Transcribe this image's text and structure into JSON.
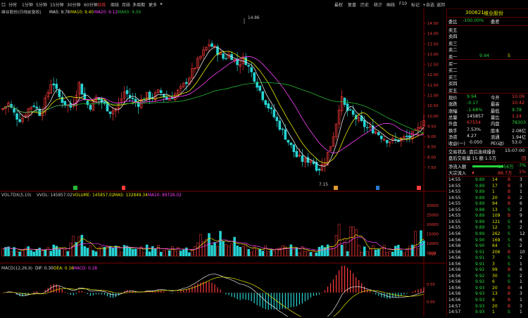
{
  "topbar": {
    "home": "口",
    "tabs": [
      {
        "label": "分时",
        "active": false
      },
      {
        "label": "1分钟",
        "active": false
      },
      {
        "label": "5分钟",
        "active": false
      },
      {
        "label": "15分钟",
        "active": false
      },
      {
        "label": "30分钟",
        "active": false
      },
      {
        "label": "60分钟",
        "active": false
      },
      {
        "label": "日线",
        "active": true
      },
      {
        "label": "周线",
        "active": false
      },
      {
        "label": "月线",
        "active": false
      },
      {
        "label": "多周期",
        "active": false
      },
      {
        "label": "更多",
        "active": false
      }
    ],
    "right_items": [
      "最权",
      "复盘",
      "历史",
      "统计",
      "画线",
      "F10",
      "标记",
      "+自选",
      "返回"
    ]
  },
  "kline": {
    "title": "维业股份(日线前复权)",
    "ma5": "MA5: 9.78",
    "ma10": "MA10: 9.40",
    "ma20": "MA20: 9.12",
    "ma60": "MA60: 9.09",
    "high_label": "14.86",
    "low_label": "7.15",
    "y_ticks": [
      "14.50",
      "14.00",
      "13.50",
      "13.00",
      "12.50",
      "12.00",
      "11.50",
      "11.00",
      "10.50",
      "10.00",
      "9.50",
      "9.00",
      "8.50",
      "8.00",
      "7.50"
    ]
  },
  "volume": {
    "title": "VOL-TDX(5,10)",
    "vvol": "VVOL: 145857.02",
    "vol": "VOLUME: 145857.02",
    "ma5": "MA5: 132849.34",
    "ma10": "MA10: 89726.02",
    "y_ticks": [
      "30000",
      "25000",
      "20000",
      "15000",
      "10000",
      "5000"
    ],
    "unit": "X10"
  },
  "macd": {
    "title": "MACD(12,26,9)",
    "dif": "DIF: 0.30",
    "dea": "DEA: 0.16",
    "macd": "MACD: 0.28",
    "y_ticks": [
      "0.50",
      "0.00"
    ]
  },
  "colors": {
    "up": "#ff3b3b",
    "down": "#27d4d4",
    "ma5": "#e6e6e6",
    "ma10": "#e8e800",
    "ma20": "#ff40ff",
    "ma60": "#27b437",
    "border": "#7a0000"
  },
  "panel": {
    "code": "300621",
    "name": "维业股份",
    "weibi_label": "委比",
    "weibi_value": "-100.00%",
    "weicha_label": "委差",
    "weicha_value": "",
    "asks": [
      "卖五",
      "卖四",
      "卖三",
      "卖二",
      "卖一"
    ],
    "ask1_price": "9.94",
    "ask1_vol": "5",
    "bids": [
      "买一",
      "买二",
      "买三",
      "买四",
      "买五"
    ],
    "quote": [
      {
        "l1": "现价",
        "v1": "9.94",
        "l2": "今开",
        "v2": "10.09"
      },
      {
        "l1": "涨跌",
        "v1": "-0.17",
        "l2": "最高",
        "v2": "10.42"
      },
      {
        "l1": "涨幅",
        "v1": "-1.68%",
        "l2": "最低",
        "v2": "9.78"
      },
      {
        "l1": "总量",
        "v1": "145857",
        "l2": "量比",
        "v2": "1.24"
      },
      {
        "l1": "外盘",
        "v1": "67554",
        "l2": "内盘",
        "v2": "78303"
      },
      {
        "l1": "换手",
        "v1": "7.53%",
        "l2": "股本",
        "v2": "2.08亿"
      },
      {
        "l1": "净资",
        "v1": "4.27",
        "l2": "流通",
        "v2": "1.94亿"
      },
      {
        "l1": "收益(一)",
        "v1": "0.050",
        "l2": "PE(动)",
        "v2": "53.0"
      }
    ],
    "status": "交易状态: 盘后连续撮合",
    "status_time": "15:07:00",
    "after_trade": "盘后交易量 15 额 1.5万",
    "after_mark": "回",
    "net_inflow_label": "净流入额",
    "net_inflow_value": "-1056万",
    "net_inflow_pct": "-7%",
    "big_inflow_label": "大宗流入",
    "big_inflow_value": "86.7万",
    "big_inflow_pct": "1%",
    "ticks": [
      [
        "14:55",
        "9.89",
        "14",
        "B",
        "3"
      ],
      [
        "14:55",
        "9.89",
        "17",
        "B",
        "3"
      ],
      [
        "14:55",
        "9.89",
        "1",
        "B",
        "1"
      ],
      [
        "14:55",
        "9.89",
        "20",
        "B",
        "2"
      ],
      [
        "14:55",
        "9.89",
        "94",
        "B",
        "6"
      ],
      [
        "14:55",
        "9.88",
        "13",
        "S",
        "2"
      ],
      [
        "14:55",
        "9.89",
        "109",
        "B",
        "9"
      ],
      [
        "14:55",
        "9.89",
        "121",
        "S",
        "4"
      ],
      [
        "14:55",
        "9.89",
        "12",
        "S",
        "2"
      ],
      [
        "14:56",
        "9.89",
        "262",
        "S",
        "12"
      ],
      [
        "14:56",
        "9.90",
        "169",
        "S",
        "6"
      ],
      [
        "14:56",
        "9.90",
        "64",
        "S",
        "2"
      ],
      [
        "14:56",
        "9.91",
        "206",
        "B",
        "10"
      ],
      [
        "14:56",
        "9.91",
        "7",
        "S",
        "2"
      ],
      [
        "14:56",
        "9.91",
        "3",
        "S",
        "1"
      ],
      [
        "14:56",
        "9.92",
        "99",
        "B",
        "6"
      ],
      [
        "14:56",
        "9.92",
        "30",
        "S",
        "2"
      ],
      [
        "14:56",
        "9.92",
        "6",
        "S",
        "1"
      ],
      [
        "14:56",
        "9.93",
        "20",
        "B",
        "4"
      ],
      [
        "14:56",
        "9.93",
        "13",
        "B",
        "3"
      ],
      [
        "14:56",
        "9.93",
        "6",
        "B",
        "1"
      ],
      [
        "14:57",
        "9.93",
        "20",
        "B",
        "3"
      ],
      [
        "14:57",
        "9.93",
        "1",
        "S",
        "1"
      ]
    ]
  }
}
